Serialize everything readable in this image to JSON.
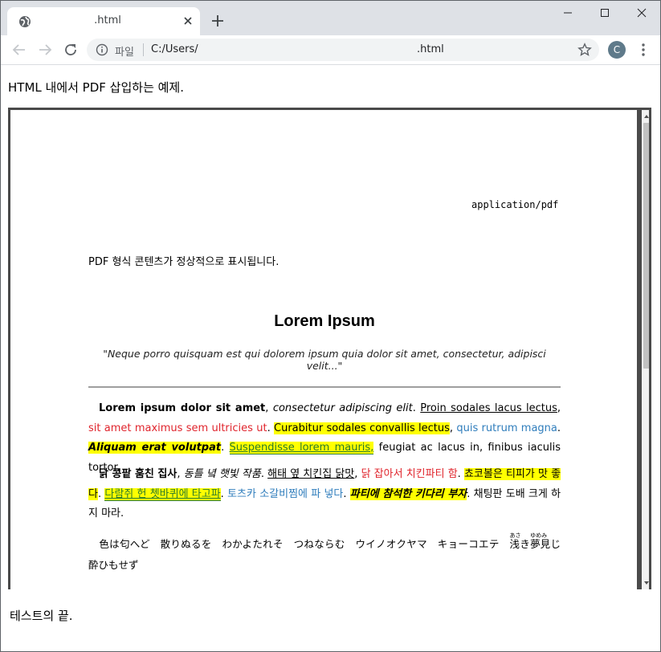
{
  "browser": {
    "tab_title": ".html",
    "new_tab_label": "+",
    "address": {
      "scheme_label": "파일",
      "path": "C:/Users/",
      "file": ".html"
    },
    "avatar_letter": "C"
  },
  "page": {
    "intro": "HTML 내에서 PDF 삽입하는 예제.",
    "outro": "테스트의 끝."
  },
  "pdf": {
    "mime": "application/pdf",
    "note": "PDF 형식 콘텐츠가 정상적으로 표시됩니다.",
    "title": "Lorem Ipsum",
    "quote": "\"Neque porro quisquam est qui dolorem ipsum quia dolor sit amet, consectetur, adipisci velit...\"",
    "p1": {
      "s1": "Lorem ipsum dolor sit amet",
      "s2": ", ",
      "s3": "consectetur adipiscing elit",
      "s4": ". ",
      "s5": "Proin sodales lacus lectus",
      "s6": ", ",
      "s7": "sit amet maximus sem ultricies ut",
      "s8": ". ",
      "s9": "Curabitur sodales convallis lectus",
      "s10": ", ",
      "s11": "quis rutrum magna",
      "s12": ". ",
      "s13": "Aliquam erat volutpat",
      "s14": ". ",
      "s15": "Suspendisse lorem mauris,",
      "s16": " feugiat ac lacus in, finibus iaculis tortor."
    },
    "p2": {
      "s1": "닭 콩팥 훔친 집사",
      "s2": ", ",
      "s3": "동틀 녘 햇빛 작품",
      "s4": ". ",
      "s5": "해태 옆 치킨집 닭맛",
      "s6": ", ",
      "s7": "닭 잡아서 치킨파티 함",
      "s8": ". ",
      "s9": "쵸코볼은 티피가 맛 좋다",
      "s10": ". ",
      "s11": "다람쥐 헌 쳇바퀴에 타고파",
      "s12": ". ",
      "s13": "토츠카 소갈비찜에 파 넣다",
      "s14": ". ",
      "s15": "파티에 참석한 키다리 부자",
      "s16": ". 채팅판 도배 크게 하지 마라."
    },
    "p3": {
      "text1": "色は匂へど　散りぬるを　わかよたれそ　つねならむ　ウイノオクヤマ　キョーコエテ　",
      "ruby1_base": "浅",
      "ruby1_rt": "あさ",
      "mid": "き",
      "ruby2_base": "夢見",
      "ruby2_rt": "ゆめみ",
      "text2": "じ　酔ひもせず"
    }
  },
  "colors": {
    "red_text": "#e0242c",
    "blue_text": "#2f7dbc",
    "highlight": "#ffff00",
    "tabstrip": "#dee1e6",
    "pdf_frame": "#4a4a4a"
  },
  "icons": [
    "globe-icon",
    "close-icon",
    "plus-icon",
    "minimize-icon",
    "maximize-icon",
    "window-close-icon",
    "back-icon",
    "forward-icon",
    "reload-icon",
    "info-icon",
    "star-icon",
    "kebab-menu-icon",
    "scroll-up-icon",
    "scroll-down-icon"
  ]
}
